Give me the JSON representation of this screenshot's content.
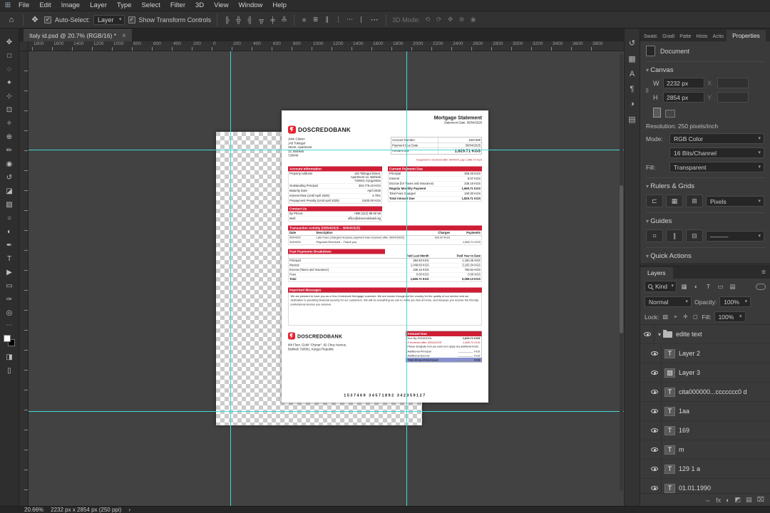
{
  "colors": {
    "accent_red": "#ce1d35",
    "logo_red": "#e8212e",
    "highlight_blue": "#8690cd",
    "guide_cyan": "#45d8d8"
  },
  "menu_bar": {
    "app_icon_glyph": "⊞",
    "items": [
      "File",
      "Edit",
      "Image",
      "Layer",
      "Type",
      "Select",
      "Filter",
      "3D",
      "View",
      "Window",
      "Help"
    ]
  },
  "options_bar": {
    "home_glyph": "⌂",
    "tool_glyph": "✥",
    "auto_select_checked": "✓",
    "auto_select_label": "Auto-Select:",
    "auto_select_value": "Layer",
    "show_transform_checked": "✓",
    "show_transform_label": "Show Transform Controls",
    "align_icons": [
      "╠",
      "╬",
      "╣",
      "╦",
      "╪",
      "╩"
    ],
    "distribute_icons": [
      "≡",
      "≣",
      "∥",
      "⋮",
      "⋯",
      "∣"
    ],
    "more_glyph": "⋯",
    "mode_label": "3D Mode:",
    "mode_icons": [
      "⟲",
      "⟳",
      "✥",
      "⊕",
      "◉"
    ]
  },
  "document_tab": {
    "title": "Italy id.psd @ 20.7% (RGB/16) *",
    "close_glyph": "×"
  },
  "ruler": {
    "h_ticks": [
      "1800",
      "1600",
      "1400",
      "1200",
      "1000",
      "800",
      "600",
      "400",
      "200",
      "0",
      "200",
      "400",
      "600",
      "800",
      "1000",
      "1200",
      "1400",
      "1600",
      "1800",
      "2000",
      "2200",
      "2400",
      "2600",
      "2800",
      "3000",
      "3200",
      "3400",
      "3600",
      "3800"
    ]
  },
  "toolbar": {
    "tools": [
      {
        "name": "move-tool",
        "glyph": "✥"
      },
      {
        "name": "marquee-tool",
        "glyph": "□"
      },
      {
        "name": "lasso-tool",
        "glyph": "◌"
      },
      {
        "name": "quick-selection-tool",
        "glyph": "✦"
      },
      {
        "name": "crop-tool",
        "glyph": "⊹"
      },
      {
        "name": "frame-tool",
        "glyph": "⊡"
      },
      {
        "name": "eyedropper-tool",
        "glyph": "✧"
      },
      {
        "name": "healing-brush-tool",
        "glyph": "⊕"
      },
      {
        "name": "brush-tool",
        "glyph": "✏"
      },
      {
        "name": "clone-stamp-tool",
        "glyph": "◉"
      },
      {
        "name": "history-brush-tool",
        "glyph": "↺"
      },
      {
        "name": "eraser-tool",
        "glyph": "◪"
      },
      {
        "name": "gradient-tool",
        "glyph": "▨"
      },
      {
        "name": "blur-tool",
        "glyph": "○"
      },
      {
        "name": "dodge-tool",
        "glyph": "◐"
      },
      {
        "name": "pen-tool",
        "glyph": "✒"
      },
      {
        "name": "type-tool",
        "glyph": "T"
      },
      {
        "name": "path-selection-tool",
        "glyph": "▶"
      },
      {
        "name": "shape-tool",
        "glyph": "▭"
      },
      {
        "name": "hand-tool",
        "glyph": "✑"
      },
      {
        "name": "zoom-tool",
        "glyph": "◎"
      }
    ],
    "more_glyph": "⋯",
    "bottom": [
      {
        "name": "quick-mask-icon",
        "glyph": "◨"
      },
      {
        "name": "screen-mode-icon",
        "glyph": "▯"
      }
    ]
  },
  "statement": {
    "title": "Mortgage Statement",
    "statement_date": "Statement Date: 05/04/2025",
    "bank_name": "DOSCREDOBANK",
    "recipient": "John Citizen\n145 Toktogul\nStreet, Apartment\n12, Bishkek\n720040",
    "account_box": {
      "rows": [
        {
          "label": "Account Number",
          "value": "1537469"
        },
        {
          "label": "Payment Due Date",
          "value": "30/04/2025"
        },
        {
          "label": "Amount Due",
          "value": "1,829.71 KGS"
        }
      ],
      "note": "If payment is received after 30/04/25, pay 1,989.72 KGS"
    },
    "account_info": {
      "header": "Account Information",
      "rows": [
        {
          "label": "Property Address",
          "value": "145 Toktogul Street,\nApartment 12, Bishkek\n720040, Kyrgyzstan"
        },
        {
          "label": "Outstanding Principal",
          "value": "384,776.43 KGS"
        },
        {
          "label": "Maturity Date",
          "value": "April 2025"
        },
        {
          "label": "Interest Rate (Until April 2025)",
          "value": "4.75%"
        },
        {
          "label": "Prepayment Penalty (Until April 2025)",
          "value": "3,500.00 KGS"
        }
      ]
    },
    "contact": {
      "header": "Contact Us",
      "rows": [
        {
          "label": "By Phone:",
          "value": "+996 (312) 98 60 59"
        },
        {
          "label": "Mail:",
          "value": "office@doscredobank.kg"
        }
      ]
    },
    "current_payment": {
      "header": "Current Payment Due",
      "rows": [
        {
          "label": "Principal",
          "value": "366.46 KGS"
        },
        {
          "label": "Interest",
          "value": "8.07 KGS"
        },
        {
          "label": "Escrow (for Taxes and Insurance)",
          "value": "235.16 KGS"
        },
        {
          "label": "Regular Monthly Payment",
          "value": "1,669.71 KGS"
        },
        {
          "label": "Total Fees Charged",
          "value": "160.00 KGS"
        },
        {
          "label": "Total Amount Due",
          "value": "1,829.71 KGS"
        }
      ]
    },
    "transactions": {
      "header": "Transaction Activity (05/04/2025 – 30/04/2025)",
      "columns": [
        "Date",
        "Description",
        "Charges",
        "Payments"
      ],
      "rows": [
        {
          "date": "05/04/25",
          "description": "Late Fees (charged because payment was received after 30/04/2025)",
          "charges": "160.00 KGS",
          "payments": ""
        },
        {
          "date": "30/04/25",
          "description": "Payment Received – Thank you.",
          "charges": "",
          "payments": "1,669.71 KGS"
        }
      ]
    },
    "past_payments": {
      "header": "Past Payments Breakdown",
      "columns": [
        "",
        "Paid Last Month",
        "Paid Year to Date"
      ],
      "rows": [
        {
          "label": "Principal",
          "last_month": "384.93 KGS",
          "year_to_date": "1,150.25 KGS"
        },
        {
          "label": "Interest",
          "last_month": "1,049.60 KGS",
          "year_to_date": "3,153.34 KGS"
        },
        {
          "label": "Escrow (Taxes and Insurance)",
          "last_month": "235.16 KGS",
          "year_to_date": "765.54 KGS"
        },
        {
          "label": "Fees",
          "last_month": "0.00 KGS",
          "year_to_date": "0.00 KGS"
        },
        {
          "label": "Total",
          "last_month": "1,669.71 KGS",
          "year_to_date": "5,069.13 KGS"
        }
      ]
    },
    "important_messages": {
      "header": "Important Messages",
      "body": "We are pleased to have you as a Dos-Credobank Mortgage customer. We are known throughout the country for the quality of our service and our dedication to providing financial security for our customers. We will do everything we can to make you feel at home, and because you receive the friendly, professional service you deserve."
    },
    "footer": {
      "bank_name": "DOSCREDOBANK",
      "address": "6th Floor, GUM \"Chynar\", 92 Chuy Avenue,\nBishkek 720001, Kyrgyz Republic",
      "amount_due": {
        "header": "Amount Due",
        "rows": [
          {
            "label": "Due By 30/04/2025:",
            "value": "1,829.71 KGS"
          },
          {
            "label": "If received after 30/04/2025:",
            "value": "1,989.72 KGS"
          }
        ],
        "note": "Please designate how you want us to apply any additional funds:",
        "extra_rows": [
          {
            "label": "Additional Principal",
            "value": "KGS"
          },
          {
            "label": "Additional Escrow",
            "value": "KGS"
          },
          {
            "label": "Total Amount Enclosed",
            "value": "KGS"
          }
        ]
      },
      "reference": "1537469 34571892 342359127"
    }
  },
  "right_rail": {
    "icons": [
      {
        "name": "history-icon",
        "glyph": "↺"
      },
      {
        "name": "swatches-icon",
        "glyph": "▦"
      },
      {
        "name": "character-icon",
        "glyph": "A"
      },
      {
        "name": "paragraph-icon",
        "glyph": "¶"
      },
      {
        "name": "adjustments-icon",
        "glyph": "◑"
      },
      {
        "name": "libraries-icon",
        "glyph": "▤"
      }
    ]
  },
  "panels": {
    "tabs": [
      "Swatc",
      "Gradi",
      "Patte",
      "Histo",
      "Actio"
    ],
    "properties_tab": "Properties",
    "properties": {
      "doc_label": "Document",
      "canvas_section": "Canvas",
      "link_glyph": "∞",
      "w_label": "W",
      "w_value": "2232 px",
      "h_label": "H",
      "h_value": "2854 px",
      "x_label": "X",
      "y_label": "Y",
      "resolution": "Resolution: 250 pixels/inch",
      "mode_label": "Mode:",
      "mode_value": "RGB Color",
      "depth_value": "16 Bits/Channel",
      "fill_label": "Fill:",
      "fill_value": "Transparent",
      "rulers_section": "Rulers & Grids",
      "rg_icons": [
        "⊏",
        "▦",
        "⊞"
      ],
      "units_value": "Pixels",
      "guides_section": "Guides",
      "guide_icons": [
        "⌗",
        "∥",
        "⊟"
      ],
      "guides_style_value": "———",
      "quick_actions_section": "Quick Actions"
    },
    "layers": {
      "tab": "Layers",
      "menu_glyph": "≡",
      "kind_label": "Kind",
      "filter_icons": [
        "▦",
        "◐",
        "T",
        "▭",
        "▤"
      ],
      "blend_value": "Normal",
      "opacity_label": "Opacity:",
      "opacity_value": "100%",
      "lock_label": "Lock:",
      "lock_icons": [
        "▨",
        "⌖",
        "✛",
        "◻"
      ],
      "fill_label": "Fill:",
      "fill_value": "100%",
      "group_chevron": "▾",
      "group_name": "edite text",
      "items": [
        {
          "thumb": "T",
          "name": "Layer 2"
        },
        {
          "thumb": "▨",
          "name": "Layer 3"
        },
        {
          "thumb": "T",
          "name": "cita000000...ccccccc0 d"
        },
        {
          "thumb": "T",
          "name": "1aa"
        },
        {
          "thumb": "T",
          "name": "169"
        },
        {
          "thumb": "T",
          "name": "m"
        },
        {
          "thumb": "T",
          "name": "129 1 a"
        },
        {
          "thumb": "T",
          "name": "01.01.1990"
        }
      ],
      "bottom_icons": [
        "⇔",
        "fx",
        "◐",
        "◩",
        "▤",
        "⌧"
      ]
    }
  },
  "status_bar": {
    "zoom": "20.66%",
    "doc_info": "2232 px x 2854 px (250 ppi)",
    "chevron": "›"
  }
}
